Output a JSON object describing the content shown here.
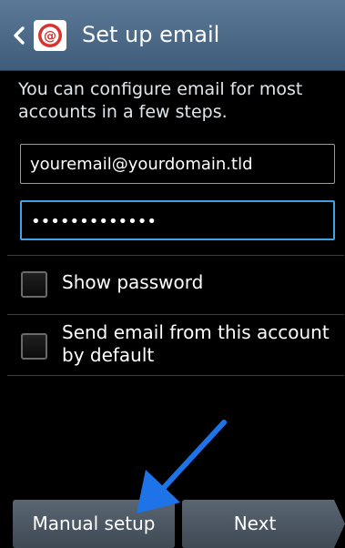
{
  "header": {
    "title": "Set up email",
    "back_icon": "chevron-left-icon",
    "app_icon": "email-app-icon",
    "colors": {
      "bar_top": "#5c7a97",
      "bar_bottom": "#3f5d7a",
      "app_icon_red": "#d9332f"
    }
  },
  "form": {
    "intro_text": "You can configure email for most accounts in a few steps.",
    "email_value": "youremail@yourdomain.tld",
    "password_value": "•••••••••••••",
    "focus_color": "#3fa1e6"
  },
  "options": {
    "show_password_label": "Show password",
    "show_password_checked": false,
    "default_account_label": "Send email from this account by default",
    "default_account_checked": false
  },
  "buttons": {
    "manual_setup_label": "Manual setup",
    "next_label": "Next"
  },
  "annotation": {
    "arrow_icon": "pointer-arrow-icon",
    "arrow_color": "#1e73e8"
  }
}
